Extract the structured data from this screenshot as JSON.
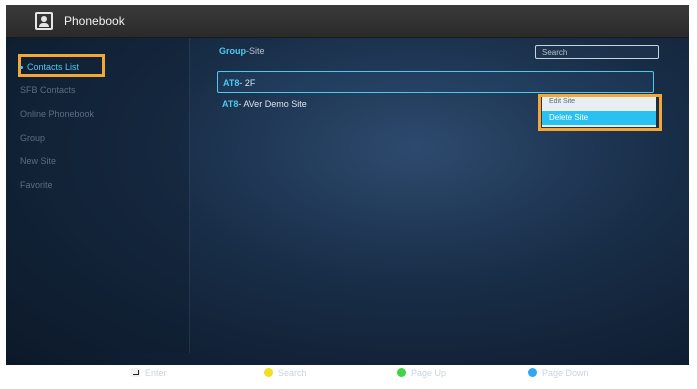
{
  "titlebar": {
    "title": "Phonebook",
    "icon": "phonebook-icon"
  },
  "sidebar": {
    "items": [
      {
        "label": "Contacts List",
        "active": true
      },
      {
        "label": "SFB Contacts"
      },
      {
        "label": "Online Phonebook"
      },
      {
        "label": "Group"
      },
      {
        "label": "New Site"
      },
      {
        "label": "Favorite"
      }
    ]
  },
  "list": {
    "header_group": "Group",
    "header_site": "-Site",
    "search_placeholder": "Search",
    "rows": [
      {
        "code": "AT8",
        "name": "- 2F",
        "selected": true
      },
      {
        "code": "AT8",
        "name": "- AVer Demo Site"
      }
    ]
  },
  "context_menu": {
    "items": [
      {
        "label": "Edit Site"
      },
      {
        "label": "Delete Site",
        "hover": true
      }
    ]
  },
  "footer": {
    "items": [
      {
        "label": "Enter",
        "icon": "enter-key-icon"
      },
      {
        "label": "Search",
        "color": "#f0e020"
      },
      {
        "label": "Page Up",
        "color": "#3fd444"
      },
      {
        "label": "Page Down",
        "color": "#2fa8f0"
      }
    ]
  },
  "colors": {
    "accent": "#4fc8f0",
    "highlight": "#f5a733"
  }
}
